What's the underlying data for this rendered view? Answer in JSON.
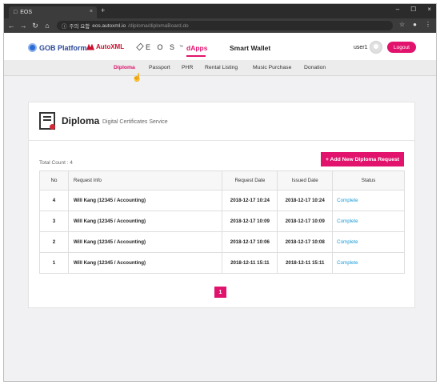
{
  "browser": {
    "tab_title": "EOS",
    "tab_close": "×",
    "new_tab": "+",
    "url_prefix": "주의 요함",
    "url_host": "eos.autoxml.io",
    "url_path": "/diploma/diplomaBoard.do",
    "win_min": "–",
    "win_max": "☐",
    "win_close": "×"
  },
  "header": {
    "gob_label": "GOB Platform",
    "autoxml_label": "AutoXML",
    "eos_label": "E O S",
    "eos_tm": "™",
    "nav_dapps": "dApps",
    "nav_wallet": "Smart Wallet",
    "user_name": "user1",
    "logout_label": "Logout"
  },
  "subnav": {
    "items": [
      {
        "label": "Diploma",
        "active": true
      },
      {
        "label": "Passport",
        "active": false
      },
      {
        "label": "PHR",
        "active": false
      },
      {
        "label": "Rental Listing",
        "active": false
      },
      {
        "label": "Music Purchase",
        "active": false
      },
      {
        "label": "Donation",
        "active": false
      }
    ]
  },
  "card": {
    "title": "Diploma",
    "subtitle": "Digital Certificates Service",
    "total_count": "Total Count : 4",
    "add_button": "+ Add New Diploma Request"
  },
  "table": {
    "headers": [
      "No",
      "Request Info",
      "Request Date",
      "Issued Date",
      "Status"
    ],
    "rows": [
      {
        "no": "4",
        "info": "Will Kang (12345 / Accounting)",
        "request_date": "2018-12-17 10:24",
        "issued_date": "2018-12-17 10:24",
        "status": "Complete"
      },
      {
        "no": "3",
        "info": "Will Kang (12345 / Accounting)",
        "request_date": "2018-12-17 10:09",
        "issued_date": "2018-12-17 10:09",
        "status": "Complete"
      },
      {
        "no": "2",
        "info": "Will Kang (12345 / Accounting)",
        "request_date": "2018-12-17 10:06",
        "issued_date": "2018-12-17 10:08",
        "status": "Complete"
      },
      {
        "no": "1",
        "info": "Will Kang (12345 / Accounting)",
        "request_date": "2018-12-11 15:11",
        "issued_date": "2018-12-11 15:11",
        "status": "Complete"
      }
    ]
  },
  "pagination": {
    "current": "1"
  },
  "colors": {
    "accent": "#e1136d",
    "link": "#1a9bd7",
    "gob_blue": "#2c6bd6",
    "autoxml_red": "#c8102e"
  },
  "icons": [
    "page-icon",
    "back-icon",
    "forward-icon",
    "reload-icon",
    "home-icon",
    "info-icon",
    "star-icon",
    "account-icon",
    "menu-icon",
    "gob-logo-icon",
    "autoxml-logo-icon",
    "eos-logo-icon",
    "avatar-icon",
    "diploma-icon",
    "pointer-cursor-icon"
  ]
}
